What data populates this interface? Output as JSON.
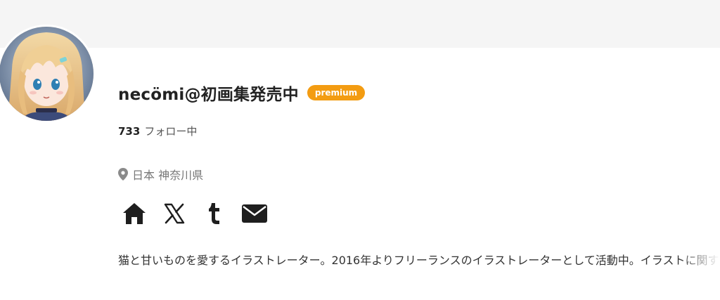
{
  "profile": {
    "username": "necömi@初画集発売中",
    "badge": "premium",
    "following_count": "733",
    "following_label": "フォロー中",
    "location": "日本 神奈川県",
    "bio": "猫と甘いものを愛するイラストレーター。2016年よりフリーランスのイラストレーターとして活動中。イラストに関す　フ"
  },
  "social_links": [
    {
      "icon": "home-icon"
    },
    {
      "icon": "x-icon"
    },
    {
      "icon": "tumblr-icon"
    },
    {
      "icon": "mail-icon"
    }
  ],
  "colors": {
    "badge_bg": "#f39c12",
    "banner_bg": "#f5f5f5",
    "text_primary": "#222222",
    "text_muted": "#777777",
    "icon": "#1e1e1e"
  }
}
